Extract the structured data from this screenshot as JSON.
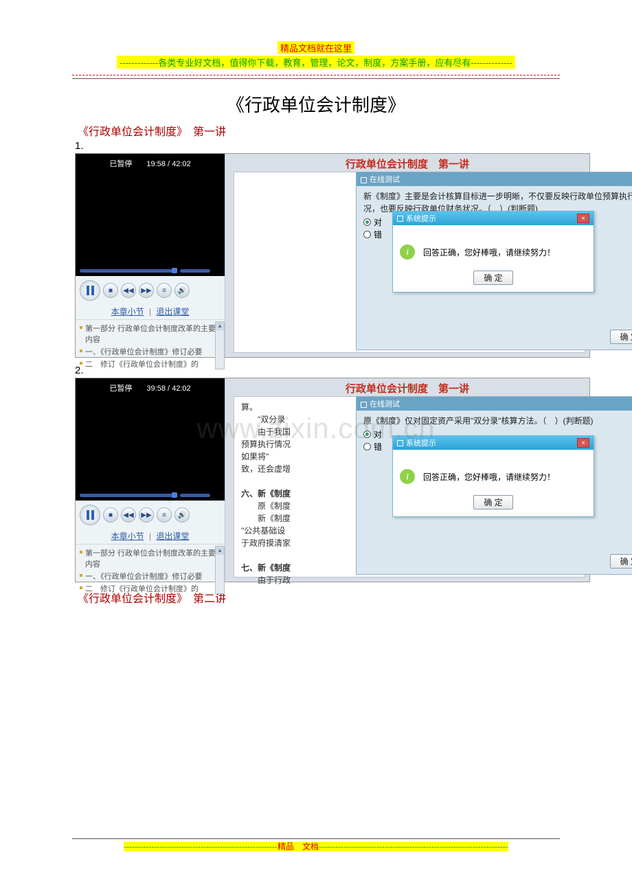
{
  "header": {
    "line1": "精品文档就在这里",
    "line2": "-------------各类专业好文档，值得你下载，教育，管理，论文，制度，方案手册，应有尽有--------------"
  },
  "doc_title": "《行政单位会计制度》",
  "sections": [
    {
      "heading": "《行政单位会计制度》　第一讲"
    },
    {
      "heading": "《行政单位会计制度》　第二讲"
    }
  ],
  "item_numbers": {
    "one": "1.",
    "two": "2."
  },
  "player": {
    "status": "已暂停",
    "time1": "19:58 / 42:02",
    "time2": "39:58 / 42:02",
    "nav": {
      "chapter": "本章小节",
      "exit": "退出课堂",
      "sep": "|"
    },
    "chapters": [
      "第一部分 行政单位会计制度改革的主要内容",
      "一、《行政单位会计制度》修订必要",
      "二　修订《行政单位会计制度》的"
    ]
  },
  "lectures": {
    "title": "行政单位会计制度　第一讲"
  },
  "content2": {
    "lines": [
      "算。",
      "　　\"双分录",
      "　　由于我国",
      "预算执行情况",
      "如果将\"",
      "致，还会虚增",
      "",
      "六、新《制度",
      "　　原《制度",
      "　　新《制度",
      "\"公共基础设",
      "于政府摸清家",
      "",
      "七、新《制度",
      "　　由于行政"
    ]
  },
  "test_panel": {
    "header": "在线测试",
    "q1": "新《制度》主要是会计核算目标进一步明晰，不仅要反映行政单位预算执行情况，也要反映行政单位财务状况。（　）(判断题)",
    "q2": "原《制度》仅对固定资产采用\"双分录\"核算方法。（　）(判断题)",
    "opt_true": "对",
    "opt_false": "错",
    "submit": "确 定"
  },
  "tip": {
    "title": "系统提示",
    "message": "回答正确，您好棒哦，请继续努力！",
    "ok": "确 定",
    "close": "×"
  },
  "watermark": "www.zixin.com.cn",
  "footer": {
    "dashes_left": "--------------------------------------------------------",
    "label": "精品　文档",
    "dashes_right": "---------------------------------------------------------------------"
  }
}
